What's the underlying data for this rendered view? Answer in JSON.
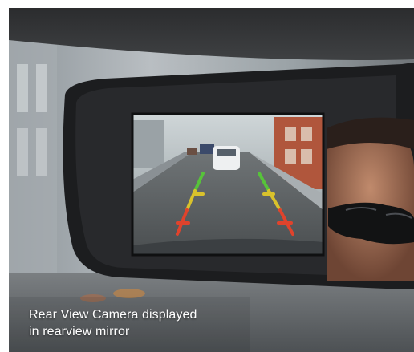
{
  "photo": {
    "subject": "rear-view-camera-mirror-photo",
    "caption": {
      "line1": "Rear View Camera displayed",
      "line2": "in rearview mirror"
    }
  },
  "colors": {
    "mirror_body": "#1c1d1f",
    "screen_road": "#5a5e60",
    "guide_green": "#57c23a",
    "guide_yellow": "#d9c22c",
    "guide_red": "#e0432c",
    "caption_text": "#ffffff"
  }
}
